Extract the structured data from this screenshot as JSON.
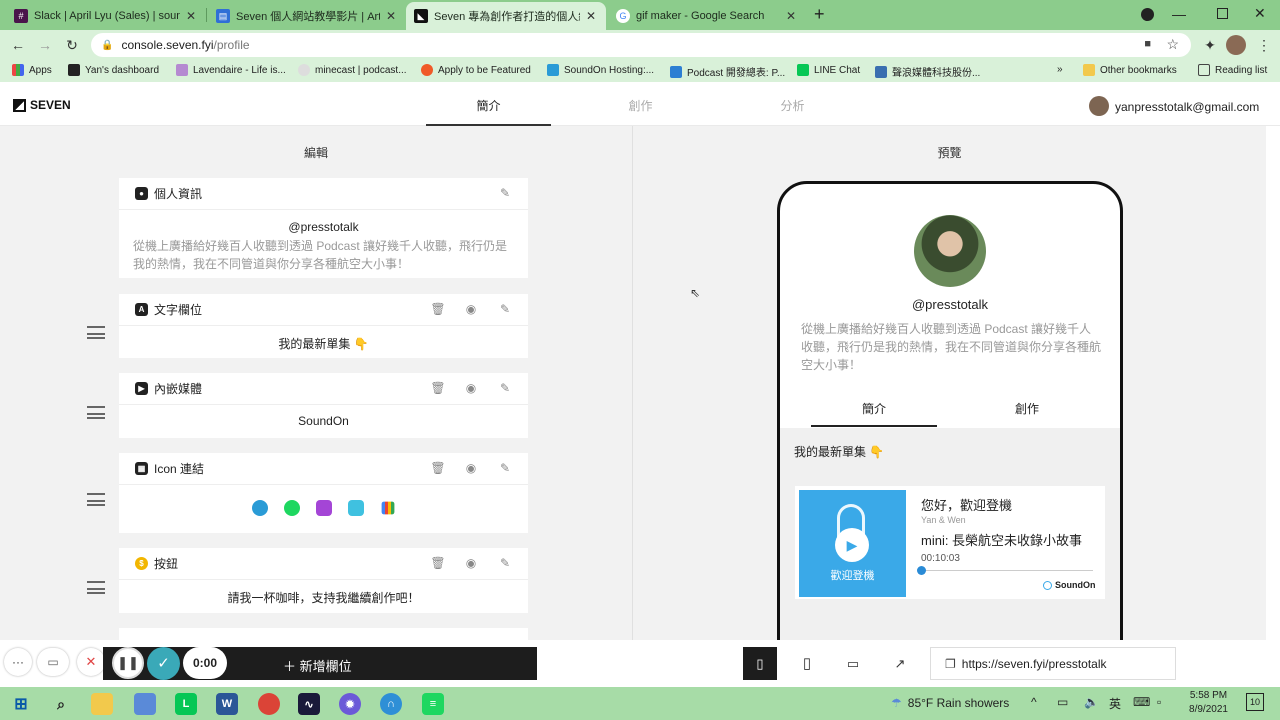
{
  "browser": {
    "tabs": [
      {
        "title": "Slack | April Lyu (Sales) | soundon",
        "icon": "slack-icon"
      },
      {
        "title": "Seven 個人網站教學影片 | Article",
        "icon": "article-icon"
      },
      {
        "title": "Seven 專為創作者打造的個人網站",
        "icon": "seven-icon",
        "active": true
      },
      {
        "title": "gif maker - Google Search",
        "icon": "google-icon"
      }
    ],
    "new_tab": "+",
    "url_host": "console.seven.fyi",
    "url_path": "/profile",
    "bookmarks": [
      "Apps",
      "Yan's dashboard",
      "Lavendaire - Life is...",
      "minecast | podcast...",
      "Apply to be Featured",
      "SoundOn Hosting:...",
      "Podcast 開發總表: P...",
      "LINE Chat",
      "聲浪媒體科技股份...",
      "»",
      "Other bookmarks",
      "Reading list"
    ]
  },
  "app": {
    "logo": "SEVEN",
    "nav": [
      "簡介",
      "創作",
      "分析"
    ],
    "user_email": "yanpresstotalk@gmail.com"
  },
  "editor": {
    "title": "編輯",
    "profile_card": {
      "header": "個人資訊",
      "handle": "@presstotalk",
      "bio": "從機上廣播給好幾百人收聽到透過 Podcast 讓好幾千人收聽，飛行仍是我的熱情，我在不同管道與你分享各種航空大小事！"
    },
    "text_card": {
      "header": "文字欄位",
      "content": "我的最新單集 👇"
    },
    "embed_card": {
      "header": "內嵌媒體",
      "content": "SoundOn"
    },
    "icon_card": {
      "header": "Icon 連結",
      "icons": [
        "soundon-icon",
        "spotify-icon",
        "apple-podcasts-icon",
        "castbox-icon",
        "google-podcasts-icon"
      ]
    },
    "button_card": {
      "header": "按鈕",
      "content": "請我一杯咖啡，支持我繼續創作吧！"
    },
    "add_field": "新增欄位"
  },
  "preview": {
    "title": "預覽",
    "handle": "@presstotalk",
    "bio": "從機上廣播給好幾百人收聽到透過 Podcast 讓好幾千人收聽，飛行仍是我的熱情，我在不同管道與你分享各種航空大小事！",
    "tabs": [
      "簡介",
      "創作"
    ],
    "text_block": "我的最新單集 👇",
    "player": {
      "show_title": "您好，歡迎登機",
      "author": "Yan & Wen",
      "episode": "mini: 長榮航空未收錄小故事",
      "time": "00:10:03",
      "cover_text": "歡迎登機",
      "brand": "SoundOn",
      "progress": 0.0
    },
    "public_url": "https://seven.fyi/presstotalk"
  },
  "recorder": {
    "timer": "0:00"
  },
  "taskbar": {
    "weather": "85°F  Rain showers",
    "ime": "英",
    "time": "5:58 PM",
    "date": "8/9/2021",
    "notifications": "10"
  }
}
